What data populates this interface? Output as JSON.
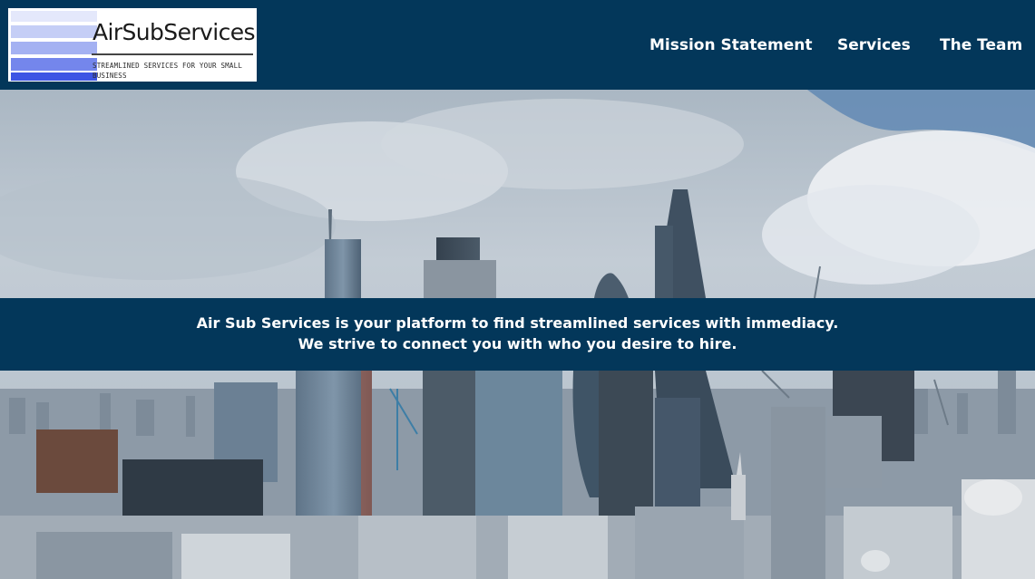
{
  "logo": {
    "name": "AirSubServices",
    "tagline": "STREAMLINED SERVICES FOR YOUR SMALL BUSINESS"
  },
  "nav": {
    "items": [
      {
        "label": "Mission Statement"
      },
      {
        "label": "Services"
      },
      {
        "label": "The Team"
      }
    ]
  },
  "hero": {
    "line1": "Air Sub Services is your platform to find streamlined services with immediacy.",
    "line2": "We strive to connect you with who you desire to hire."
  },
  "colors": {
    "header_bg": "#03375a",
    "banner_bg": "#03375a",
    "nav_text": "#ffffff"
  }
}
